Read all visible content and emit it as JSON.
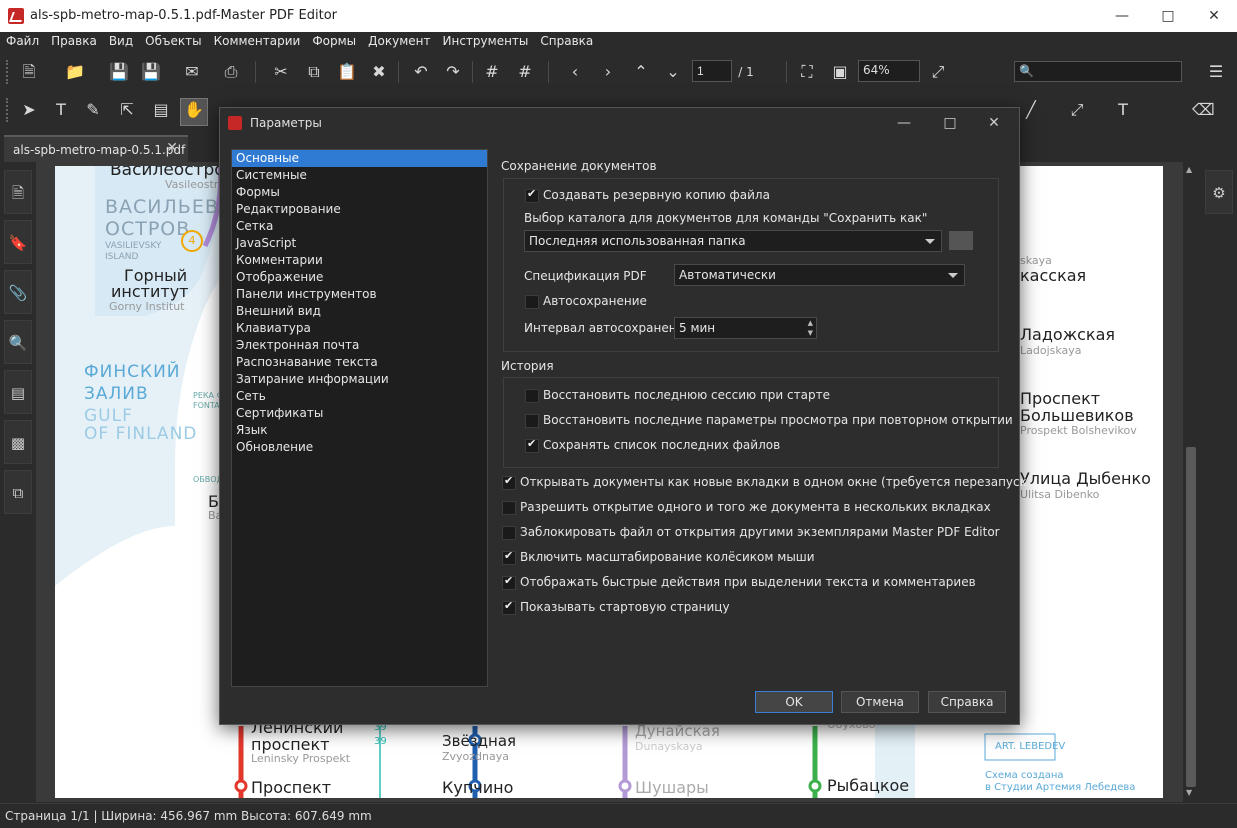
{
  "window": {
    "title": "als-spb-metro-map-0.5.1.pdf-Master PDF Editor"
  },
  "menu": [
    "Файл",
    "Правка",
    "Вид",
    "Объекты",
    "Комментарии",
    "Формы",
    "Документ",
    "Инструменты",
    "Справка"
  ],
  "toolbar": {
    "page_current": "1",
    "page_total": "/ 1",
    "zoom": "64%"
  },
  "tab": {
    "label": "als-spb-metro-map-0.5.1.pdf"
  },
  "map": {
    "labels_left": {
      "vasileostrov": "Василеостров",
      "vasileostrov_lat": "Vasileostro",
      "vo_1": "ВАСИЛЬЕВСК",
      "vo_2": "ОСТРОВ",
      "vo_3": "VASILIEVSKY",
      "vo_4": "ISLAND",
      "circle_num": "4",
      "gorny_1": "Горный",
      "gorny_2": "институт",
      "gorny_lat": "Gorny Institut",
      "fz_1": "ФИНСКИЙ",
      "fz_2": "ЗАЛИВ",
      "fz_3": "GULF",
      "fz_4": "OF FINLAND",
      "reka_1": "РЕКА Ф",
      "reka_2": "FONTA",
      "obvod": "ОБВОД",
      "b_1": "Б",
      "b_2": "Ba"
    },
    "labels_right": {
      "s1": "skaya",
      "s2": "касская",
      "lad": "Ладожская",
      "lad_lat": "Ladojskaya",
      "pb_1": "Проспект",
      "pb_2": "Большевиков",
      "pb_lat": "Prospekt Bolshevikov",
      "dyb": "Улица Дыбенко",
      "dyb_lat": "Ulitsa Dibenko"
    },
    "labels_bottom": {
      "len_1": "Ленинский",
      "len_2": "проспект",
      "len_lat": "Leninsky Prospekt",
      "n39a": "39",
      "n39b": "39",
      "zv": "Звёздная",
      "zv_lat": "Zvyozdnaya",
      "dun": "Дунайская",
      "dun_lat": "Dunayskaya",
      "obukh": "Обухово",
      "prosp": "Проспект",
      "kup": "Купчино",
      "shu": "Шушары",
      "ryb": "Рыбацкое",
      "logo": "ART. LEBEDEV",
      "credit_1": "Схема создана",
      "credit_2": "в Студии Артемия Лебедева"
    }
  },
  "dialog": {
    "title": "Параметры",
    "categories": [
      "Основные",
      "Системные",
      "Формы",
      "Редактирование",
      "Сетка",
      "JavaScript",
      "Комментарии",
      "Отображение",
      "Панели инструментов",
      "Внешний вид",
      "Клавиатура",
      "Электронная почта",
      "Распознавание текста",
      "Затирание информации",
      "Сеть",
      "Сертификаты",
      "Язык",
      "Обновление"
    ],
    "selected_category": "Основные",
    "save_group": {
      "title": "Сохранение документов",
      "backup": {
        "label": "Создавать резервную копию файла",
        "checked": true
      },
      "dir_label": "Выбор каталога для документов для команды \"Сохранить как\"",
      "dir_value": "Последняя использованная папка",
      "pdf_spec_label": "Спецификация PDF",
      "pdf_spec_value": "Автоматически",
      "autosave": {
        "label": "Автосохранение",
        "checked": false
      },
      "interval_label": "Интервал автосохранения:",
      "interval_value": "5 мин"
    },
    "history_group": {
      "title": "История",
      "restore_session": {
        "label": "Восстановить последнюю сессию при старте",
        "checked": false
      },
      "restore_view": {
        "label": "Восстановить последние параметры просмотра при повторном открытии",
        "checked": false
      },
      "keep_recent": {
        "label": "Сохранять список последних файлов",
        "checked": true
      }
    },
    "options": [
      {
        "label": "Открывать документы как новые вкладки в одном окне (требуется перезапуск)",
        "checked": true
      },
      {
        "label": "Разрешить открытие одного и того же документа в нескольких вкладках",
        "checked": false
      },
      {
        "label": "Заблокировать файл от открытия другими экземплярами Master PDF Editor",
        "checked": false
      },
      {
        "label": "Включить масштабирование колёсиком мыши",
        "checked": true
      },
      {
        "label": "Отображать быстрые действия при выделении текста и комментариев",
        "checked": true
      },
      {
        "label": "Показывать стартовую страницу",
        "checked": true
      }
    ],
    "buttons": {
      "ok": "OK",
      "cancel": "Отмена",
      "help": "Справка"
    }
  },
  "status": {
    "text": "Страница 1/1 | Ширина: 456.967 mm Высота: 607.649 mm"
  }
}
